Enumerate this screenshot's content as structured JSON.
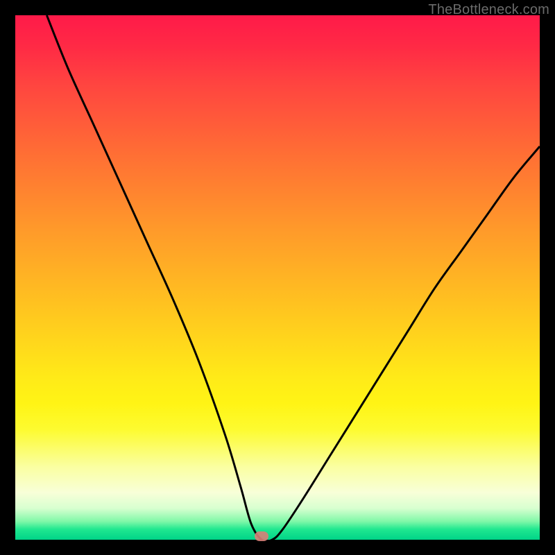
{
  "watermark": "TheBottleneck.com",
  "marker": {
    "x_pct": 47.0,
    "y_pct": 99.0
  },
  "colors": {
    "frame": "#000000",
    "curve": "#000000",
    "marker": "#d88078",
    "watermark": "#6b6b6b"
  },
  "chart_data": {
    "type": "line",
    "title": "",
    "xlabel": "",
    "ylabel": "",
    "xlim": [
      0,
      100
    ],
    "ylim": [
      0,
      100
    ],
    "series": [
      {
        "name": "bottleneck-curve",
        "x": [
          6,
          10,
          15,
          20,
          25,
          30,
          35,
          40,
          43,
          45,
          47,
          49,
          51,
          55,
          60,
          65,
          70,
          75,
          80,
          85,
          90,
          95,
          100
        ],
        "values": [
          100,
          90,
          79,
          68,
          57,
          46,
          34,
          20,
          10,
          3,
          0,
          0,
          2,
          8,
          16,
          24,
          32,
          40,
          48,
          55,
          62,
          69,
          75
        ]
      }
    ],
    "annotations": [
      {
        "type": "marker",
        "x": 47,
        "y": 0.5,
        "label": "optimal-point"
      }
    ],
    "background_gradient": {
      "top": "#ff1a49",
      "mid": "#ffd61c",
      "bottom": "#00d488"
    }
  }
}
